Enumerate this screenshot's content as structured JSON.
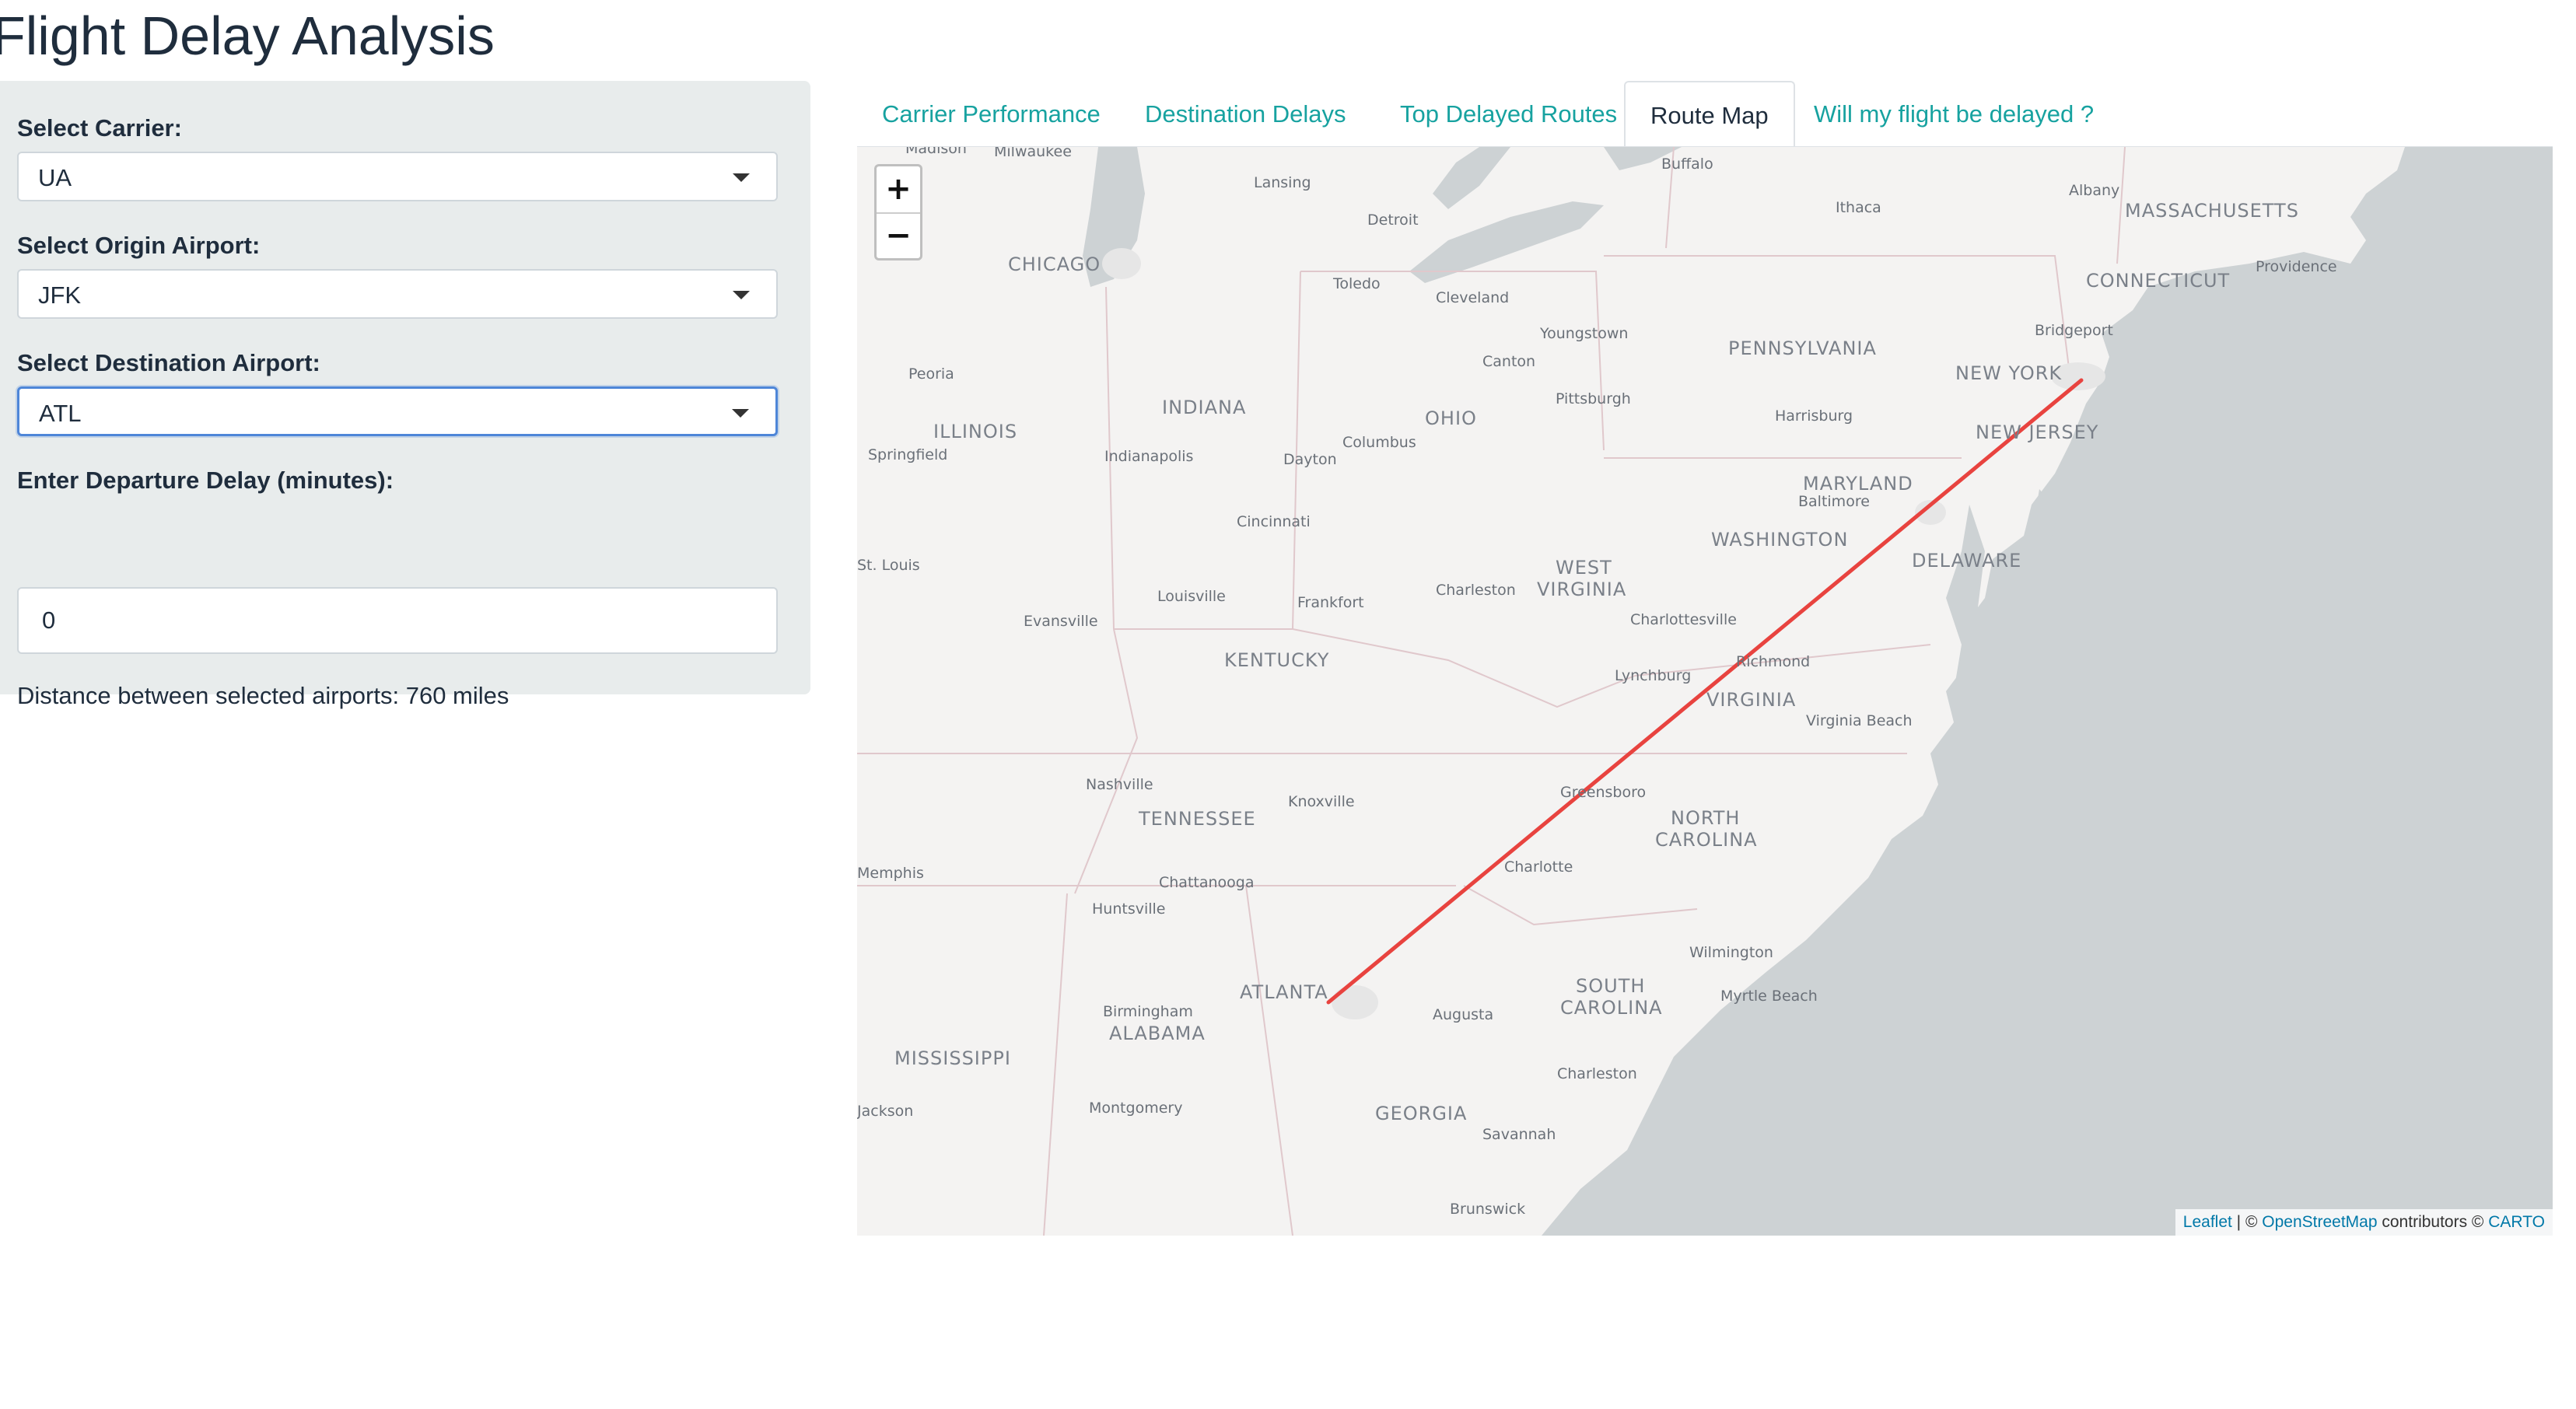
{
  "app": {
    "title": "Flight Delay Analysis"
  },
  "sidebar": {
    "carrier": {
      "label": "Select Carrier:",
      "value": "UA"
    },
    "origin": {
      "label": "Select Origin Airport:",
      "value": "JFK"
    },
    "destination": {
      "label": "Select Destination Airport:",
      "value": "ATL"
    },
    "delay": {
      "label": "Enter Departure Delay (minutes):",
      "value": "0"
    },
    "distance_text": "Distance between selected airports: 760 miles"
  },
  "tabs": [
    {
      "label": "Carrier Performance",
      "active": false
    },
    {
      "label": "Destination Delays",
      "active": false
    },
    {
      "label": "Top Delayed Routes",
      "active": false
    },
    {
      "label": "Route Map",
      "active": true
    },
    {
      "label": "Will my flight be delayed ?",
      "active": false
    }
  ],
  "map": {
    "zoom_in": "+",
    "zoom_out": "−",
    "attribution": {
      "leaflet": "Leaflet",
      "separator": " | © ",
      "osm": "OpenStreetMap",
      "middle": " contributors © ",
      "carto": "CARTO"
    },
    "route": {
      "from": "JFK",
      "to": "ATL",
      "color": "#e8433f"
    },
    "state_labels": [
      "MASSACHUSETTS",
      "CONNECTICUT",
      "PENNSYLVANIA",
      "NEW YORK",
      "NEW JERSEY",
      "MARYLAND",
      "WASHINGTON",
      "DELAWARE",
      "OHIO",
      "INDIANA",
      "ILLINOIS",
      "WEST",
      "VIRGINIA",
      "VIRGINIA",
      "KENTUCKY",
      "TENNESSEE",
      "NORTH",
      "CAROLINA",
      "SOUTH",
      "CAROLINA",
      "GEORGIA",
      "ALABAMA",
      "MISSISSIPPI",
      "ATLANTA",
      "CHICAGO"
    ],
    "city_labels": [
      "Madison",
      "Milwaukee",
      "Lansing",
      "Buffalo",
      "Albany",
      "Ithaca",
      "Providence",
      "Detroit",
      "Toledo",
      "Cleveland",
      "Youngstown",
      "Canton",
      "Pittsburgh",
      "Bridgeport",
      "Peoria",
      "Harrisburg",
      "Springfield",
      "Indianapolis",
      "Columbus",
      "Dayton",
      "Baltimore",
      "Cincinnati",
      "St. Louis",
      "Charleston",
      "Louisville",
      "Frankfort",
      "Evansville",
      "Charlottesville",
      "Richmond",
      "Lynchburg",
      "Virginia Beach",
      "Nashville",
      "Knoxville",
      "Greensboro",
      "Charlotte",
      "Memphis",
      "Chattanooga",
      "Huntsville",
      "Wilmington",
      "Myrtle Beach",
      "Birmingham",
      "Augusta",
      "Charleston",
      "Jackson",
      "Montgomery",
      "Savannah",
      "Brunswick"
    ]
  },
  "colors": {
    "accent": "#17a2a0",
    "route": "#e8433f",
    "water": "#cdd2d4",
    "land": "#f4f3f2"
  }
}
